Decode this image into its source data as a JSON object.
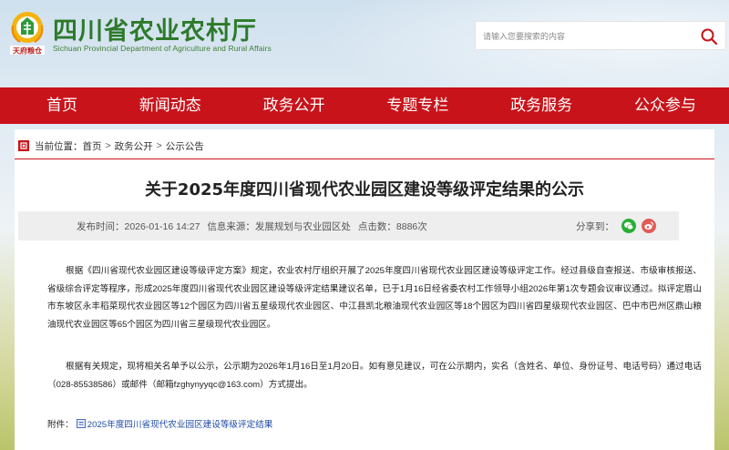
{
  "header": {
    "logo_text_cn": "四川省农业农村厅",
    "logo_text_en": "Sichuan Provincial Department of Agriculture and Rural Affairs",
    "logo_emblem_caption": "天府粮仓",
    "search_placeholder": "请输入您要搜索的内容",
    "search_icon": "search-icon",
    "accent_color": "#c8131a",
    "brand_green": "#2d7a2a"
  },
  "nav": {
    "items": [
      {
        "label": "首页"
      },
      {
        "label": "新闻动态"
      },
      {
        "label": "政务公开"
      },
      {
        "label": "专题专栏"
      },
      {
        "label": "政务服务"
      },
      {
        "label": "公众参与"
      }
    ]
  },
  "breadcrumb": {
    "prefix": "当前位置：",
    "items": [
      "首页",
      "政务公开",
      "公示公告"
    ],
    "separator": ">"
  },
  "article": {
    "title": "关于2025年度四川省现代农业园区建设等级评定结果的公示",
    "meta": {
      "publish_label": "发布时间：",
      "publish_time": "2026-01-16 14:27",
      "source_label": "信息来源：",
      "source": "发展规划与农业园区处",
      "clicks_label": "点击数：",
      "clicks": "8886次"
    },
    "share_label": "分享到：",
    "paragraph1": "根据《四川省现代农业园区建设等级评定方案》规定，农业农村厅组织开展了2025年度四川省现代农业园区建设等级评定工作。经过县级自查报送、市级审核报送、省级综合评定等程序，形成2025年度四川省现代农业园区建设等级评定结果建议名单，已于1月16日经省委农村工作领导小组2026年第1次专题会议审议通过。拟评定眉山市东坡区永丰稻菜现代农业园区等12个园区为四川省五星级现代农业园区、中江县凯北粮油现代农业园区等18个园区为四川省四星级现代农业园区、巴中市巴州区鼎山粮油现代农业园区等65个园区为四川省三星级现代农业园区。",
    "paragraph2": "根据有关规定，现将相关名单予以公示，公示期为2026年1月16日至1月20日。如有意见建议，可在公示期内，实名（含姓名、单位、身份证号、电话号码）通过电话（028-85538586）或邮件（邮箱fzghynyyqc@163.com）方式提出。",
    "attachment_label": "附件：",
    "attachment_link": "2025年度四川省现代农业园区建设等级评定结果"
  }
}
